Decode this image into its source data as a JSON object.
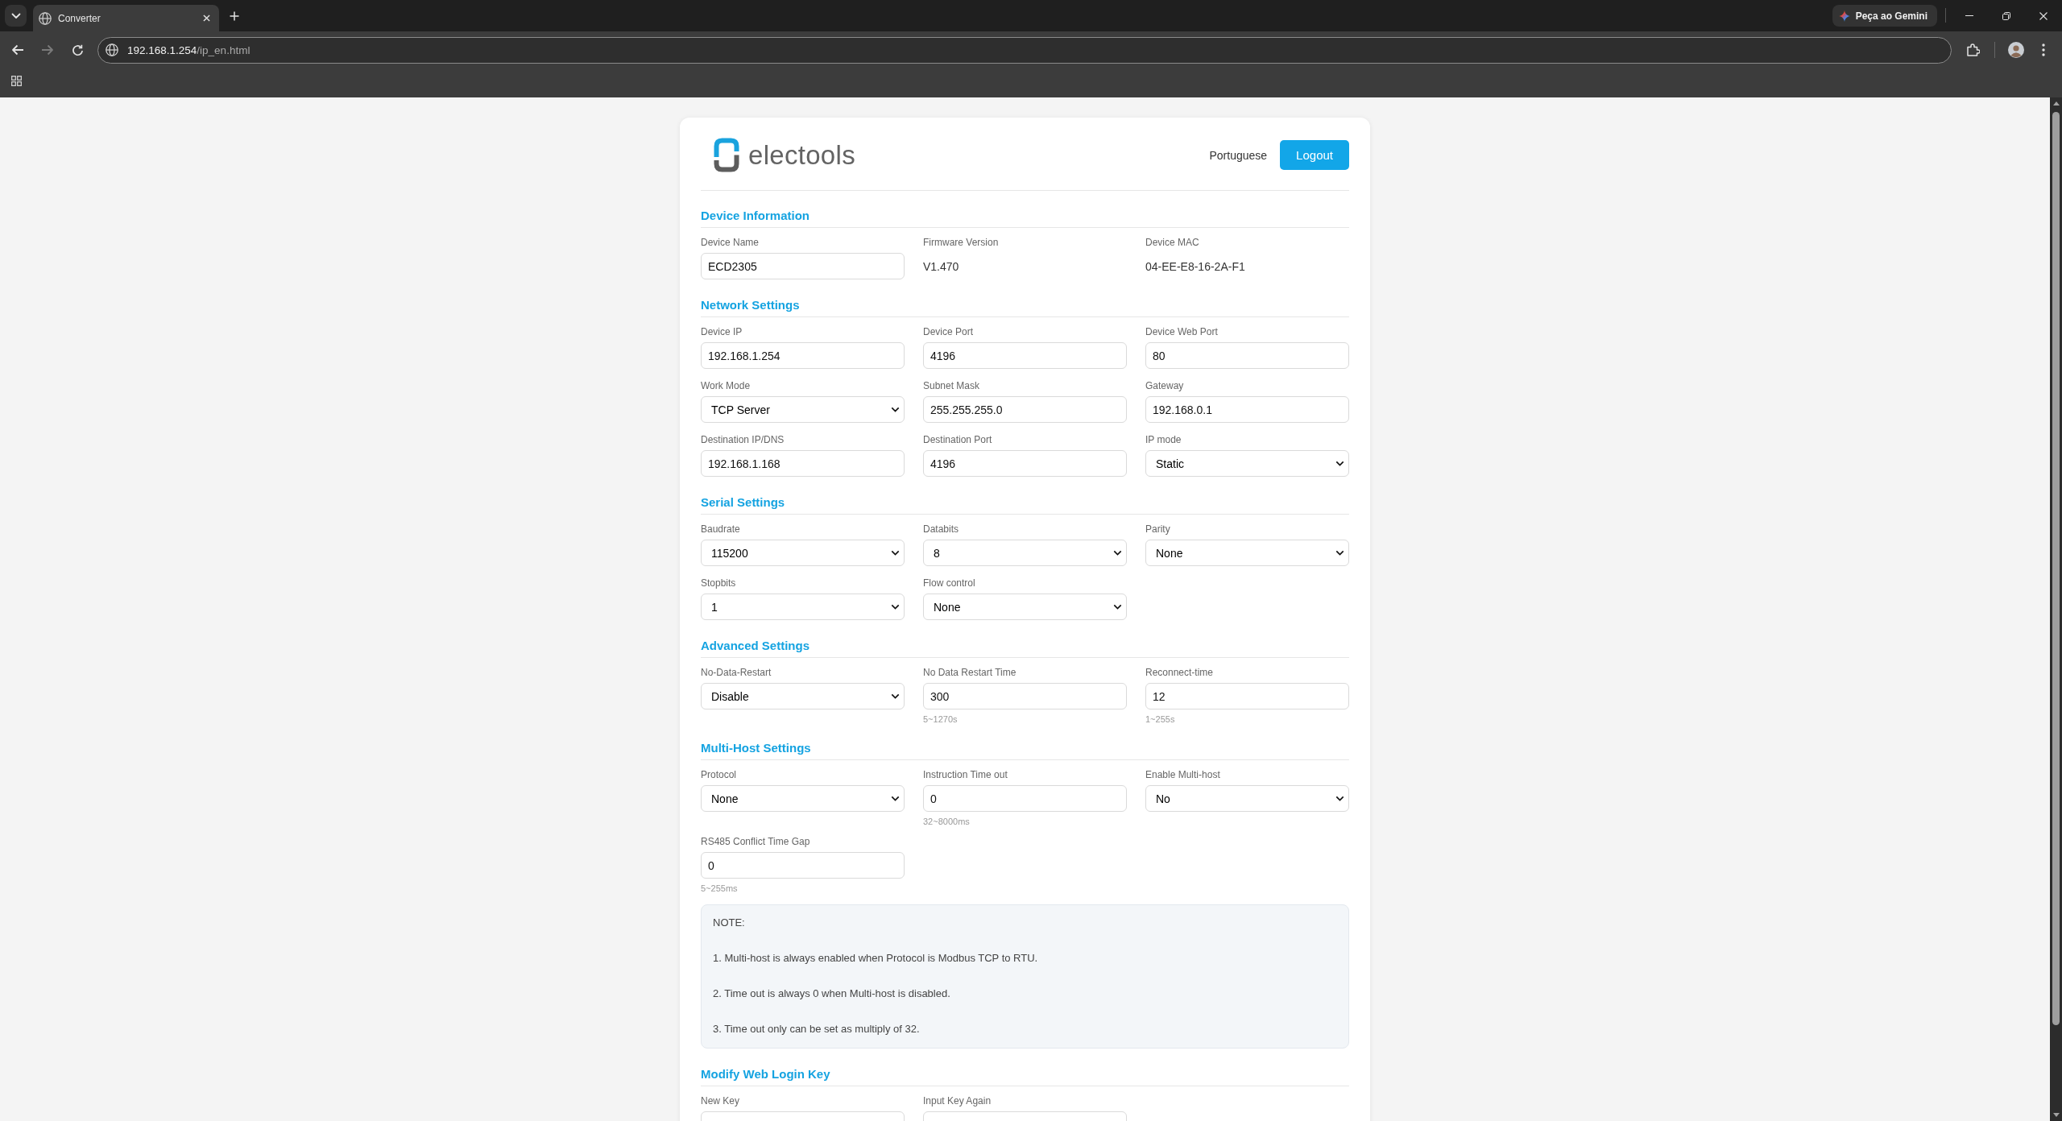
{
  "browser": {
    "tabs": [
      {
        "title": "Converter",
        "selected": true
      }
    ],
    "gemini_button": "Peça ao Gemini",
    "toolbar": {
      "back": {
        "disabled": false
      },
      "forward": {
        "disabled": true
      }
    },
    "address": {
      "host": "192.168.1.254",
      "path": "/ip_en.html"
    }
  },
  "header": {
    "logo_text": "electools",
    "language_link": "Portuguese",
    "logout_button": "Logout"
  },
  "sections": [
    {
      "title": "Device Information",
      "fields": [
        {
          "label": "Device Name",
          "kind": "input",
          "value": "ECD2305"
        },
        {
          "label": "Firmware Version",
          "kind": "text",
          "value": "V1.470"
        },
        {
          "label": "Device MAC",
          "kind": "text",
          "value": "04-EE-E8-16-2A-F1"
        }
      ]
    },
    {
      "title": "Network Settings",
      "fields": [
        {
          "label": "Device IP",
          "kind": "input",
          "value": "192.168.1.254"
        },
        {
          "label": "Device Port",
          "kind": "input",
          "value": "4196"
        },
        {
          "label": "Device Web Port",
          "kind": "input",
          "value": "80"
        },
        {
          "label": "Work Mode",
          "kind": "select",
          "value": "TCP Server"
        },
        {
          "label": "Subnet Mask",
          "kind": "input",
          "value": "255.255.255.0"
        },
        {
          "label": "Gateway",
          "kind": "input",
          "value": "192.168.0.1"
        },
        {
          "label": "Destination IP/DNS",
          "kind": "input",
          "value": "192.168.1.168"
        },
        {
          "label": "Destination Port",
          "kind": "input",
          "value": "4196"
        },
        {
          "label": "IP mode",
          "kind": "select",
          "value": "Static"
        }
      ]
    },
    {
      "title": "Serial Settings",
      "fields": [
        {
          "label": "Baudrate",
          "kind": "select",
          "value": "115200"
        },
        {
          "label": "Databits",
          "kind": "select",
          "value": "8"
        },
        {
          "label": "Parity",
          "kind": "select",
          "value": "None"
        },
        {
          "label": "Stopbits",
          "kind": "select",
          "value": "1"
        },
        {
          "label": "Flow control",
          "kind": "select",
          "value": "None"
        }
      ]
    },
    {
      "title": "Advanced Settings",
      "fields": [
        {
          "label": "No-Data-Restart",
          "kind": "select",
          "value": "Disable"
        },
        {
          "label": "No Data Restart Time",
          "kind": "input",
          "value": "300",
          "hint": "5~1270s"
        },
        {
          "label": "Reconnect-time",
          "kind": "input",
          "value": "12",
          "hint": "1~255s"
        }
      ]
    },
    {
      "title": "Multi-Host Settings",
      "fields": [
        {
          "label": "Protocol",
          "kind": "select",
          "value": "None"
        },
        {
          "label": "Instruction Time out",
          "kind": "input",
          "value": "0",
          "hint": "32~8000ms"
        },
        {
          "label": "Enable Multi-host",
          "kind": "select",
          "value": "No"
        },
        {
          "label": "RS485 Conflict Time Gap",
          "kind": "input",
          "value": "0",
          "hint": "5~255ms"
        }
      ],
      "note": {
        "title": "NOTE:",
        "items": [
          "1. Multi-host is always enabled when Protocol is Modbus TCP to RTU.",
          "2. Time out is always 0 when Multi-host is disabled.",
          "3. Time out only can be set as multiply of 32."
        ]
      }
    },
    {
      "title": "Modify Web Login Key",
      "fields": [
        {
          "label": "New Key",
          "kind": "input"
        },
        {
          "label": "Input Key Again",
          "kind": "input"
        }
      ]
    }
  ]
}
